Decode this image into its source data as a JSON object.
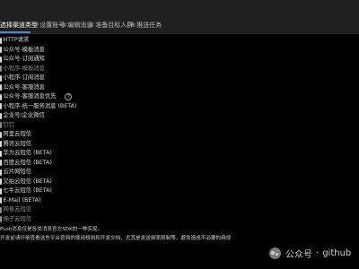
{
  "tabs": [
    {
      "label": "选择渠道类型",
      "prefix": ""
    },
    {
      "label": "设置账号",
      "prefix": "②"
    },
    {
      "label": "编辑消息",
      "prefix": "③"
    },
    {
      "label": "准备目标人群",
      "prefix": "④"
    },
    {
      "label": "推送任务",
      "prefix": "⑤"
    }
  ],
  "channels": [
    "HTTP请求",
    "公众号-模板消息",
    "公众号-订阅通知",
    "小程序-模板消息",
    "小程序-订阅消息",
    "公众号-客服消息",
    "公众号-客服消息优先",
    "小程序-统一服务消息 (BETA)",
    "企业号/企业微信",
    "钉钉",
    "阿里云短信",
    "腾讯云短信",
    "华为云短信 (BETA)",
    "百度云短信 (BETA)",
    "云片网短信",
    "又拍云短信 (BETA)",
    "七牛云短信 (BETA)",
    "E-Mail (BETA)",
    "网易云短信",
    "梯子云短信"
  ],
  "help_icon": "question-circle-icon",
  "footer": {
    "line1": "Push消息仅是各类消息官方SDK的一种实现。",
    "line2": "开发前请仔细查看这些平台官网的使用规则和开发文档，尤其是发送频率限制等，避免造成不必要的麻烦"
  },
  "watermark": {
    "brand": "公众号",
    "separator": "·",
    "account": "github"
  },
  "colors": {
    "background": "#000000",
    "tab_bar": "#1f1f1f",
    "accent": "#3a8ee6",
    "text": "#d9d9d9",
    "text_dim": "#8c8c8c"
  }
}
